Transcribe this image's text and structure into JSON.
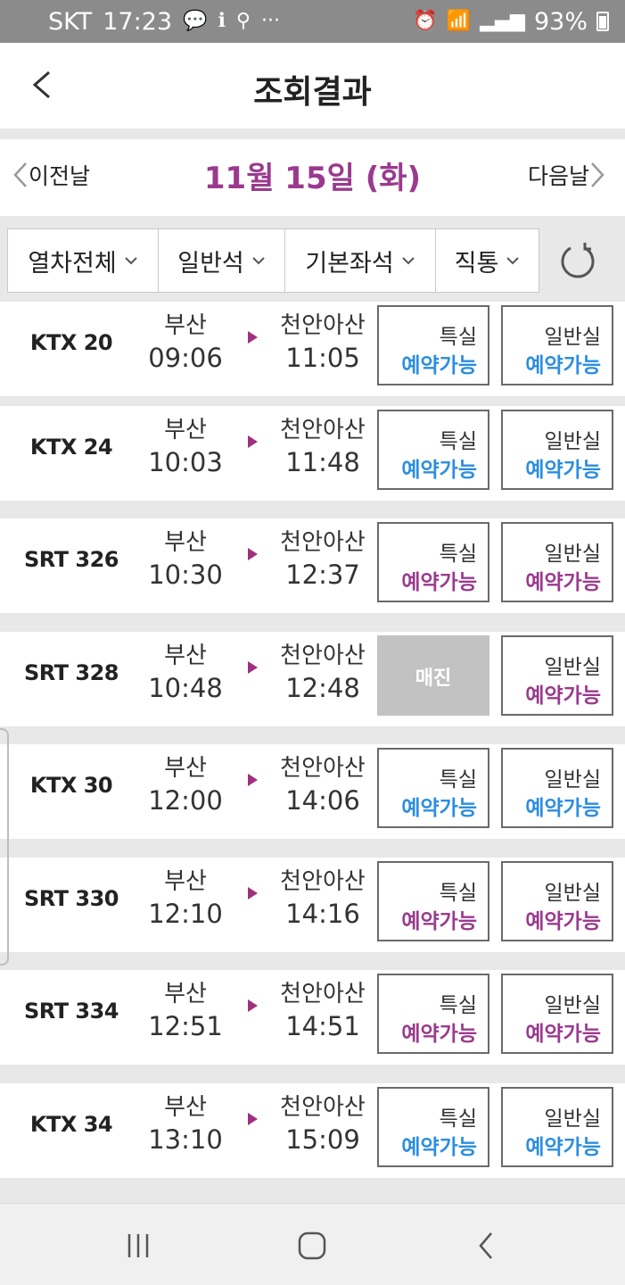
{
  "status_bar": {
    "carrier": "SKT",
    "time": "17:23",
    "left_icons": [
      "chat-icon",
      "talk-icon",
      "notification-icon",
      "broom-icon",
      "more-dots-icon"
    ],
    "more_dots": "···",
    "battery": "93%"
  },
  "header": {
    "title": "조회결과"
  },
  "date_nav": {
    "prev_label": "이전날",
    "date": "11월 15일 (화)",
    "next_label": "다음날"
  },
  "filters": [
    {
      "label": "열차전체"
    },
    {
      "label": "일반석"
    },
    {
      "label": "기본좌석"
    },
    {
      "label": "직통"
    }
  ],
  "colors": {
    "ktx_available": "#2b8ee0",
    "srt_available": "#9a3a8e",
    "date": "#9a3a8e",
    "soldout_bg": "#c2c2c2"
  },
  "trains": [
    {
      "name": "KTX 20",
      "operator": "KTX",
      "dep_station": "부산",
      "dep_time": "09:06",
      "arr_station": "천안아산",
      "arr_time": "11:05",
      "first_label": "특실",
      "first_status": "예약가능",
      "first_soldout": false,
      "normal_label": "일반실",
      "normal_status": "예약가능"
    },
    {
      "name": "KTX 24",
      "operator": "KTX",
      "dep_station": "부산",
      "dep_time": "10:03",
      "arr_station": "천안아산",
      "arr_time": "11:48",
      "first_label": "특실",
      "first_status": "예약가능",
      "first_soldout": false,
      "normal_label": "일반실",
      "normal_status": "예약가능"
    },
    {
      "name": "SRT 326",
      "operator": "SRT",
      "dep_station": "부산",
      "dep_time": "10:30",
      "arr_station": "천안아산",
      "arr_time": "12:37",
      "first_label": "특실",
      "first_status": "예약가능",
      "first_soldout": false,
      "normal_label": "일반실",
      "normal_status": "예약가능"
    },
    {
      "name": "SRT 328",
      "operator": "SRT",
      "dep_station": "부산",
      "dep_time": "10:48",
      "arr_station": "천안아산",
      "arr_time": "12:48",
      "first_label": "",
      "first_status": "매진",
      "first_soldout": true,
      "normal_label": "일반실",
      "normal_status": "예약가능"
    },
    {
      "name": "KTX 30",
      "operator": "KTX",
      "dep_station": "부산",
      "dep_time": "12:00",
      "arr_station": "천안아산",
      "arr_time": "14:06",
      "first_label": "특실",
      "first_status": "예약가능",
      "first_soldout": false,
      "normal_label": "일반실",
      "normal_status": "예약가능"
    },
    {
      "name": "SRT 330",
      "operator": "SRT",
      "dep_station": "부산",
      "dep_time": "12:10",
      "arr_station": "천안아산",
      "arr_time": "14:16",
      "first_label": "특실",
      "first_status": "예약가능",
      "first_soldout": false,
      "normal_label": "일반실",
      "normal_status": "예약가능"
    },
    {
      "name": "SRT 334",
      "operator": "SRT",
      "dep_station": "부산",
      "dep_time": "12:51",
      "arr_station": "천안아산",
      "arr_time": "14:51",
      "first_label": "특실",
      "first_status": "예약가능",
      "first_soldout": false,
      "normal_label": "일반실",
      "normal_status": "예약가능"
    },
    {
      "name": "KTX 34",
      "operator": "KTX",
      "dep_station": "부산",
      "dep_time": "13:10",
      "arr_station": "천안아산",
      "arr_time": "15:09",
      "first_label": "특실",
      "first_status": "예약가능",
      "first_soldout": false,
      "normal_label": "일반실",
      "normal_status": "예약가능"
    }
  ]
}
